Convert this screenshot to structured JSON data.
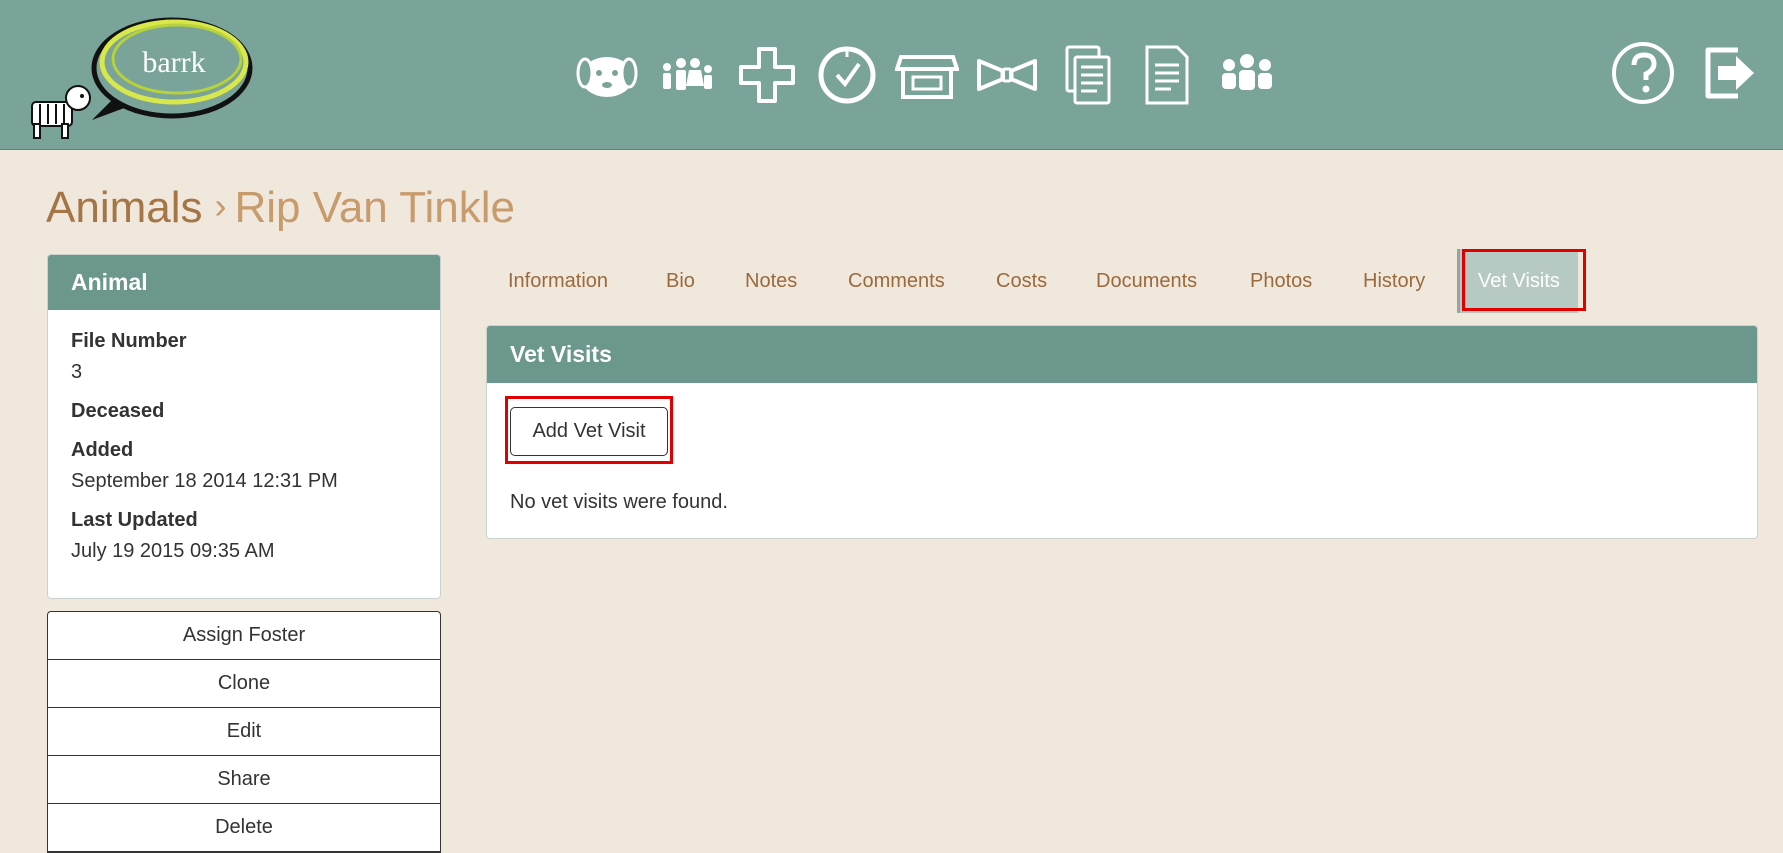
{
  "app": {
    "logo_text": "barrk"
  },
  "nav": {
    "icons": [
      "animals-icon",
      "people-icon",
      "medical-icon",
      "tasks-icon",
      "store-icon",
      "events-icon",
      "documents-icon",
      "reports-icon",
      "users-icon"
    ],
    "help_icon": "help-icon",
    "logout_icon": "logout-icon"
  },
  "breadcrumb": {
    "root": "Animals",
    "separator": "›",
    "current": "Rip Van Tinkle"
  },
  "animal_panel": {
    "title": "Animal",
    "fields": [
      {
        "label": "File Number",
        "value": "3"
      },
      {
        "label": "Deceased",
        "value": ""
      },
      {
        "label": "Added",
        "value": "September 18 2014 12:31 PM"
      },
      {
        "label": "Last Updated",
        "value": "July 19 2015 09:35 AM"
      }
    ]
  },
  "actions": [
    "Assign Foster",
    "Clone",
    "Edit",
    "Share",
    "Delete"
  ],
  "tabs": [
    "Information",
    "Bio",
    "Notes",
    "Comments",
    "Costs",
    "Documents",
    "Photos",
    "History",
    "Vet Visits"
  ],
  "active_tab": "Vet Visits",
  "vet_visits": {
    "title": "Vet Visits",
    "add_button": "Add Vet Visit",
    "empty_message": "No vet visits were found."
  },
  "colors": {
    "header": "#7aa399",
    "panel_head": "#6b978c",
    "background": "#f1e8dd",
    "link": "#9a6a3c",
    "highlight": "#e00000"
  }
}
